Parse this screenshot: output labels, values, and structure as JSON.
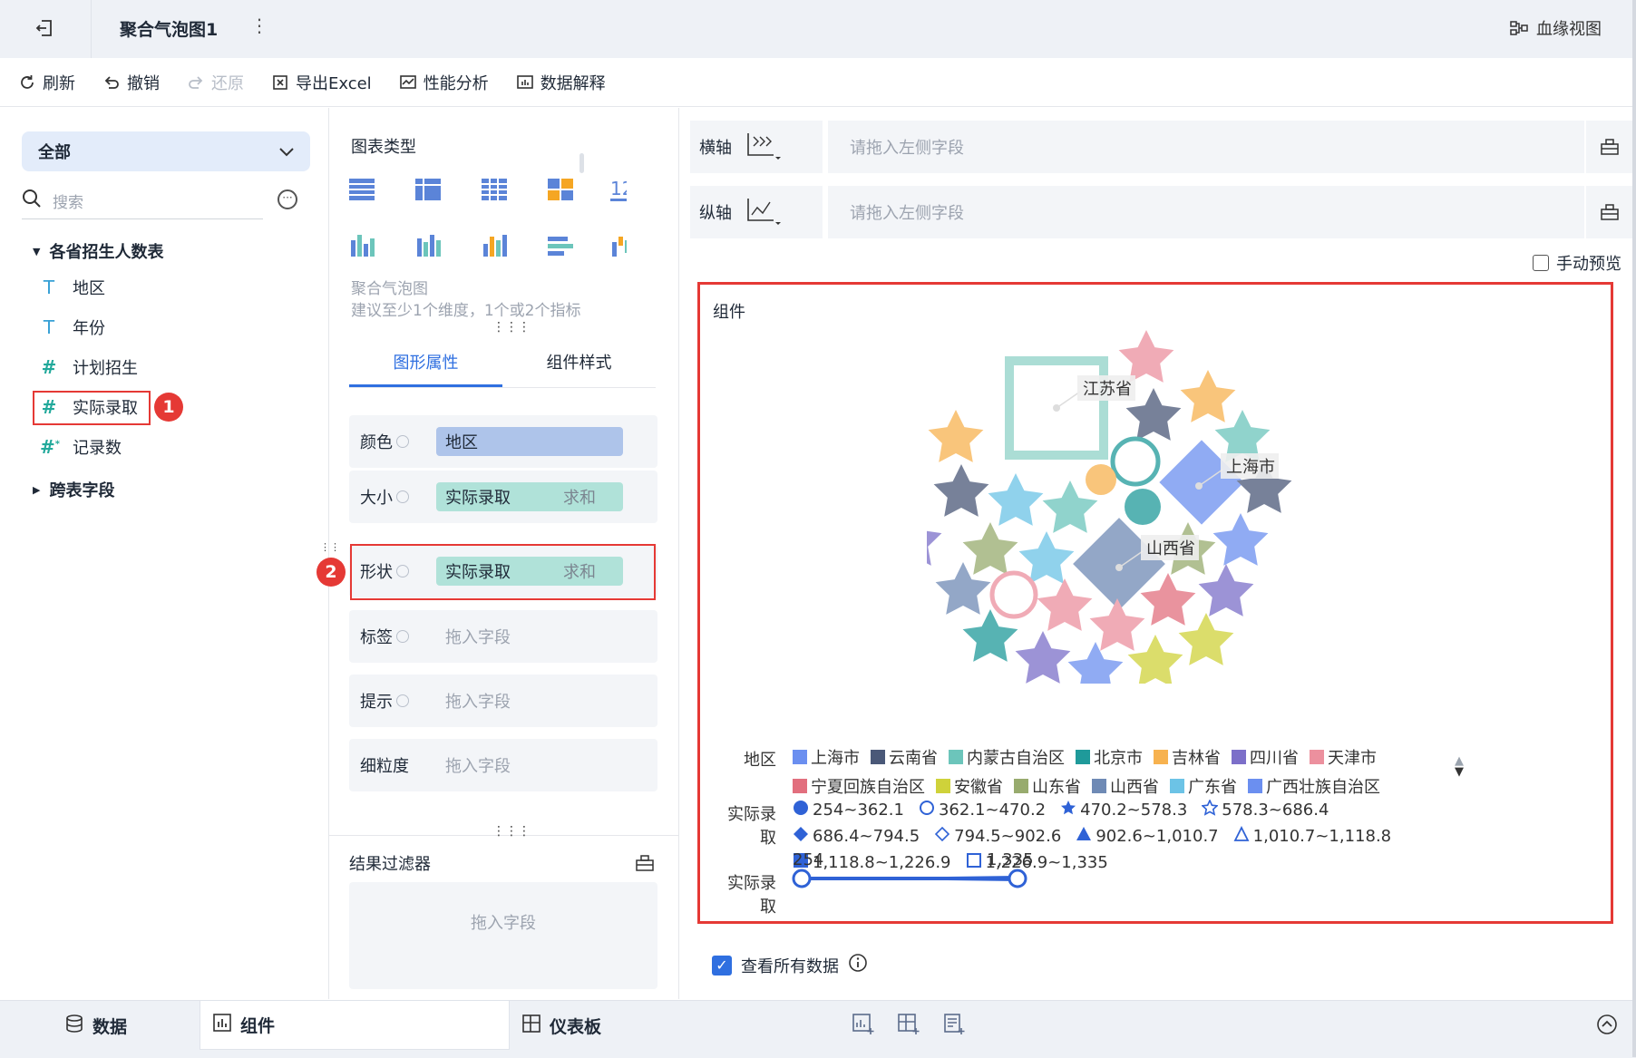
{
  "header": {
    "title": "聚合气泡图1",
    "more": "⋮",
    "lineage": "血缘视图"
  },
  "toolbar": {
    "refresh": "刷新",
    "undo": "撤销",
    "redo": "还原",
    "export": "导出Excel",
    "perf": "性能分析",
    "explain": "数据解释"
  },
  "left": {
    "scope": "全部",
    "search_placeholder": "搜索",
    "table": "各省招生人数表",
    "fields": [
      {
        "label": "地区",
        "kind": "text"
      },
      {
        "label": "年份",
        "kind": "text"
      },
      {
        "label": "计划招生",
        "kind": "number"
      },
      {
        "label": "实际录取",
        "kind": "number"
      },
      {
        "label": "记录数",
        "kind": "count"
      }
    ],
    "cross": "跨表字段",
    "badge1": "1"
  },
  "mid": {
    "chart_type_label": "图表类型",
    "chart_type_name": "聚合气泡图",
    "chart_type_hint": "建议至少1个维度，1个或2个指标",
    "tabs": [
      "图形属性",
      "组件样式"
    ],
    "props": [
      {
        "label": "颜色",
        "field": "地区",
        "agg": ""
      },
      {
        "label": "大小",
        "field": "实际录取",
        "agg": "求和"
      },
      {
        "label": "形状",
        "field": "实际录取",
        "agg": "求和"
      },
      {
        "label": "标签",
        "field": "",
        "placeholder": "拖入字段"
      },
      {
        "label": "提示",
        "field": "",
        "placeholder": "拖入字段"
      },
      {
        "label": "细粒度",
        "field": "",
        "placeholder": "拖入字段"
      }
    ],
    "badge2": "2",
    "filter_title": "结果过滤器",
    "filter_placeholder": "拖入字段"
  },
  "right": {
    "x_axis": "横轴",
    "y_axis": "纵轴",
    "axis_placeholder": "请拖入左侧字段",
    "manual_preview": "手动预览",
    "panel_title": "组件",
    "bubble_labels": [
      "江苏省",
      "上海市",
      "山西省"
    ],
    "legend_color_title": "地区",
    "legend_colors": [
      {
        "name": "上海市",
        "color": "#6b8ff0"
      },
      {
        "name": "云南省",
        "color": "#4a5878"
      },
      {
        "name": "内蒙古自治区",
        "color": "#6cc5bb"
      },
      {
        "name": "北京市",
        "color": "#1f9a9a"
      },
      {
        "name": "吉林省",
        "color": "#f7b24f"
      },
      {
        "name": "四川省",
        "color": "#7c6fc9"
      },
      {
        "name": "天津市",
        "color": "#ec909e"
      },
      {
        "name": "宁夏回族自治区",
        "color": "#e26f7e"
      },
      {
        "name": "安徽省",
        "color": "#cfd23a"
      },
      {
        "name": "山东省",
        "color": "#98ab6e"
      },
      {
        "name": "山西省",
        "color": "#6f8ab5"
      },
      {
        "name": "广东省",
        "color": "#6cc3e6"
      },
      {
        "name": "广西壮族自治区",
        "color": "#6b8ff0"
      }
    ],
    "legend_shape_title": "实际录取",
    "legend_shapes": [
      {
        "range": "254~362.1",
        "shape": "circle-filled"
      },
      {
        "range": "362.1~470.2",
        "shape": "circle-outline"
      },
      {
        "range": "470.2~578.3",
        "shape": "star-filled"
      },
      {
        "range": "578.3~686.4",
        "shape": "star-outline"
      },
      {
        "range": "686.4~794.5",
        "shape": "diamond-filled"
      },
      {
        "range": "794.5~902.6",
        "shape": "diamond-outline"
      },
      {
        "range": "902.6~1,010.7",
        "shape": "triangle-filled"
      },
      {
        "range": "1,010.7~1,118.8",
        "shape": "triangle-outline"
      },
      {
        "range": "1,118.8~1,226.9",
        "shape": "square-filled"
      },
      {
        "range": "1,226.9~1,335",
        "shape": "square-outline"
      }
    ],
    "legend_size_title": "实际录取",
    "size_min": "254",
    "size_max": "1,335",
    "view_all": "查看所有数据"
  },
  "bottom": {
    "data": "数据",
    "component": "组件",
    "dashboard": "仪表板"
  }
}
